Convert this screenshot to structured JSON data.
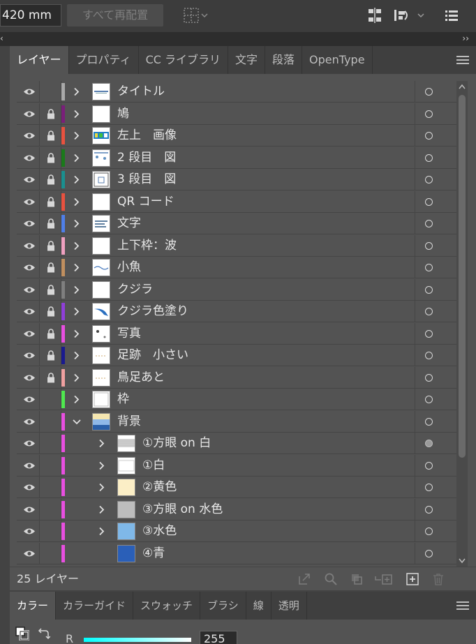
{
  "control_bar": {
    "width_value": "420 mm",
    "rearrange_button": "すべて再配置"
  },
  "collapse": {
    "left": "‹",
    "right": "››"
  },
  "layers_panel": {
    "tabs": [
      "レイヤー",
      "プロパティ",
      "CC ライブラリ",
      "文字",
      "段落",
      "OpenType"
    ],
    "active_tab": "レイヤー",
    "layers": [
      {
        "name": "タイトル",
        "color": "#a9a9a9",
        "locked": false,
        "expanded": false,
        "indent": 0,
        "thumb": "title"
      },
      {
        "name": "鳩",
        "color": "#7a1f7a",
        "locked": true,
        "expanded": false,
        "indent": 0,
        "thumb": "blank"
      },
      {
        "name": "左上　画像",
        "color": "#e8523f",
        "locked": true,
        "expanded": false,
        "indent": 0,
        "thumb": "image"
      },
      {
        "name": "2 段目　図",
        "color": "#1a7a1a",
        "locked": true,
        "expanded": false,
        "indent": 0,
        "thumb": "figure"
      },
      {
        "name": "3 段目　図",
        "color": "#1a8f8f",
        "locked": true,
        "expanded": false,
        "indent": 0,
        "thumb": "figure2"
      },
      {
        "name": "QR コード",
        "color": "#e8523f",
        "locked": true,
        "expanded": false,
        "indent": 0,
        "thumb": "blank"
      },
      {
        "name": "文字",
        "color": "#4f7fe8",
        "locked": true,
        "expanded": false,
        "indent": 0,
        "thumb": "text"
      },
      {
        "name": "上下枠：波",
        "color": "#f0a0c0",
        "locked": true,
        "expanded": false,
        "indent": 0,
        "thumb": "blank"
      },
      {
        "name": "小魚",
        "color": "#c08f5f",
        "locked": true,
        "expanded": false,
        "indent": 0,
        "thumb": "fish"
      },
      {
        "name": "クジラ",
        "color": "#7f7f7f",
        "locked": true,
        "expanded": false,
        "indent": 0,
        "thumb": "blank"
      },
      {
        "name": "クジラ色塗り",
        "color": "#8f3fd8",
        "locked": true,
        "expanded": false,
        "indent": 0,
        "thumb": "whale"
      },
      {
        "name": "写真",
        "color": "#e84fe0",
        "locked": true,
        "expanded": false,
        "indent": 0,
        "thumb": "photo"
      },
      {
        "name": "足跡　小さい",
        "color": "#1a1a8f",
        "locked": true,
        "expanded": false,
        "indent": 0,
        "thumb": "dots"
      },
      {
        "name": "鳥足あと",
        "color": "#f0a0a0",
        "locked": true,
        "expanded": false,
        "indent": 0,
        "thumb": "dots"
      },
      {
        "name": "枠",
        "color": "#4fe84f",
        "locked": false,
        "expanded": false,
        "indent": 0,
        "thumb": "frame"
      },
      {
        "name": "背景",
        "color": "#e84fe0",
        "locked": false,
        "expanded": true,
        "indent": 0,
        "thumb": "bg"
      },
      {
        "name": "①方眼 on 白",
        "color": "#e84fe0",
        "locked": false,
        "expanded": false,
        "indent": 1,
        "thumb": "grid",
        "targeted": true
      },
      {
        "name": "①白",
        "color": "#e84fe0",
        "locked": false,
        "expanded": false,
        "indent": 1,
        "thumb": "white"
      },
      {
        "name": "②黄色",
        "color": "#e84fe0",
        "locked": false,
        "expanded": false,
        "indent": 1,
        "thumb": "yellow"
      },
      {
        "name": "③方眼 on 水色",
        "color": "#e84fe0",
        "locked": false,
        "expanded": false,
        "indent": 1,
        "thumb": "gridgray"
      },
      {
        "name": "③水色",
        "color": "#e84fe0",
        "locked": false,
        "expanded": false,
        "indent": 1,
        "thumb": "lightblue"
      },
      {
        "name": "④青",
        "color": "#e84fe0",
        "locked": false,
        "expanded": false,
        "indent": 1,
        "thumb": "blue",
        "no_chevron": true
      }
    ],
    "layer_count": "25 レイヤー"
  },
  "color_panel": {
    "tabs": [
      "カラー",
      "カラーガイド",
      "スウォッチ",
      "ブラシ",
      "線",
      "透明"
    ],
    "active_tab": "カラー",
    "r_label": "R",
    "r_value": "255"
  }
}
